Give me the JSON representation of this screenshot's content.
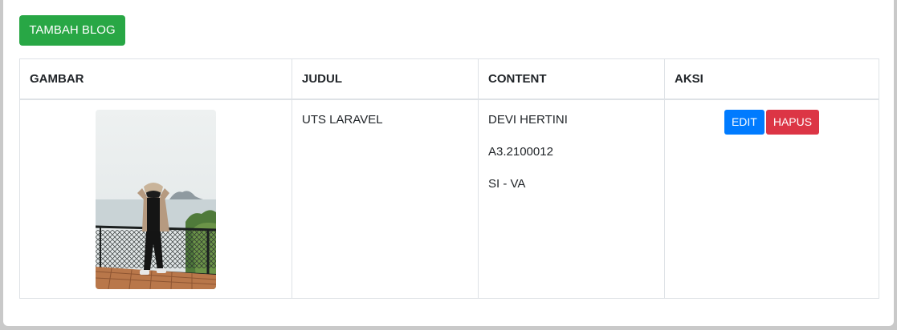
{
  "toolbar": {
    "add_label": "TAMBAH BLOG"
  },
  "table": {
    "headers": [
      "GAMBAR",
      "JUDUL",
      "CONTENT",
      "AKSI"
    ],
    "rows": [
      {
        "judul": "UTS LARAVEL",
        "content": [
          "DEVI HERTINI",
          "A3.2100012",
          "SI - VA"
        ],
        "actions": {
          "edit_label": "EDIT",
          "delete_label": "HAPUS"
        }
      }
    ]
  },
  "colors": {
    "add_button": "#28a745",
    "edit_button": "#007bff",
    "delete_button": "#dc3545"
  }
}
